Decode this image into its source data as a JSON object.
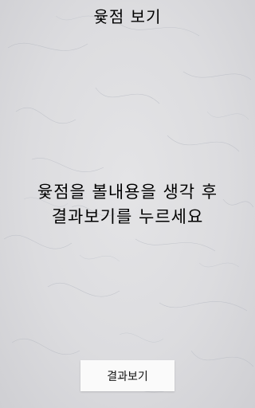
{
  "screen": {
    "title": "윷점 보기",
    "instruction_line1": "윷점을 볼내용을 생각 후",
    "instruction_line2": "결과보기를 누르세요",
    "result_button_label": "결과보기"
  }
}
